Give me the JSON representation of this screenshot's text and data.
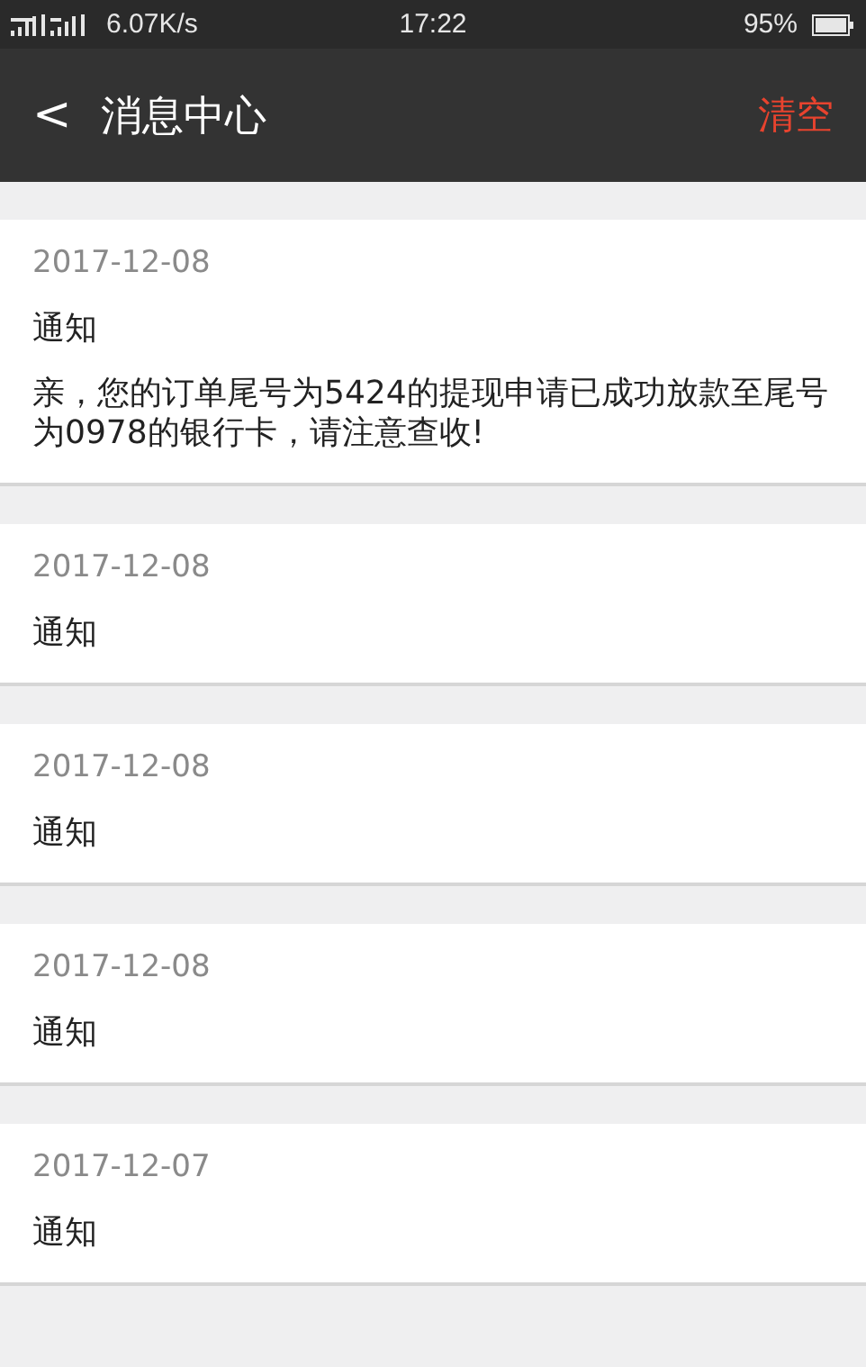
{
  "status_bar": {
    "speed": "6.07K/s",
    "time": "17:22",
    "battery": "95%"
  },
  "nav": {
    "back": "<",
    "title": "消息中心",
    "action": "清空"
  },
  "messages": [
    {
      "date": "2017-12-08",
      "title": "通知",
      "body": "亲，您的订单尾号为5424的提现申请已成功放款至尾号为0978的银行卡，请注意查收!"
    },
    {
      "date": "2017-12-08",
      "title": "通知"
    },
    {
      "date": "2017-12-08",
      "title": "通知"
    },
    {
      "date": "2017-12-08",
      "title": "通知"
    },
    {
      "date": "2017-12-07",
      "title": "通知"
    }
  ]
}
